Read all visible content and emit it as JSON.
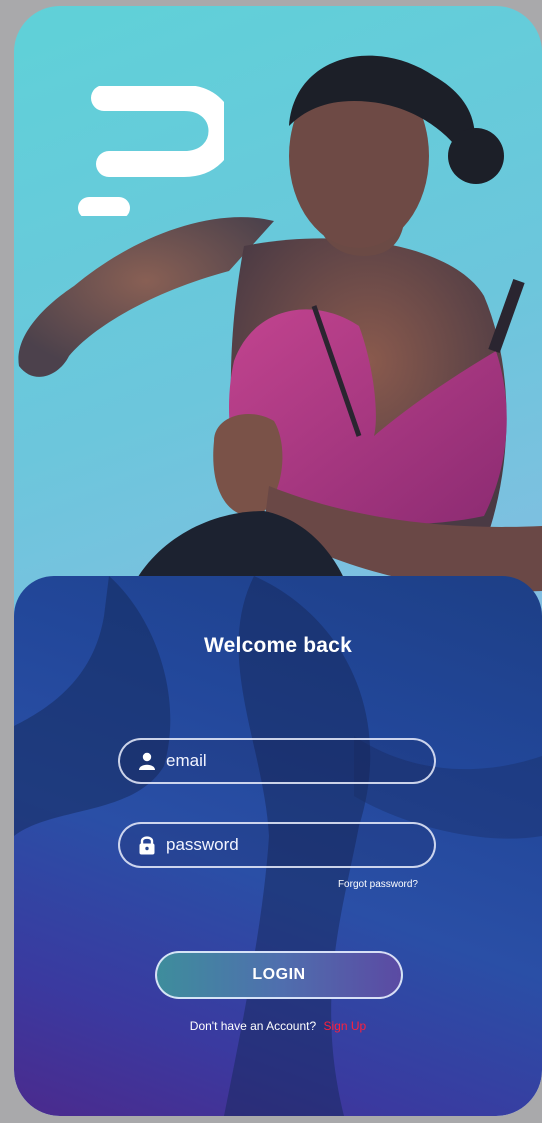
{
  "welcome": {
    "title": "Welcome back"
  },
  "form": {
    "email": {
      "placeholder": "email",
      "value": "",
      "icon": "user-icon"
    },
    "password": {
      "placeholder": "password",
      "value": "",
      "icon": "lock-icon"
    },
    "forgot_label": "Forgot password?",
    "login_label": "LOGIN",
    "signup_prompt": "Don't have an Account?",
    "signup_label": "Sign Up"
  },
  "colors": {
    "accent_link": "#ff1f3a",
    "card_top": "#1d3f86",
    "card_bottom": "#4b2a8d",
    "hero_bg": "#5fd1d8",
    "sports_bra": "#b13a85"
  }
}
